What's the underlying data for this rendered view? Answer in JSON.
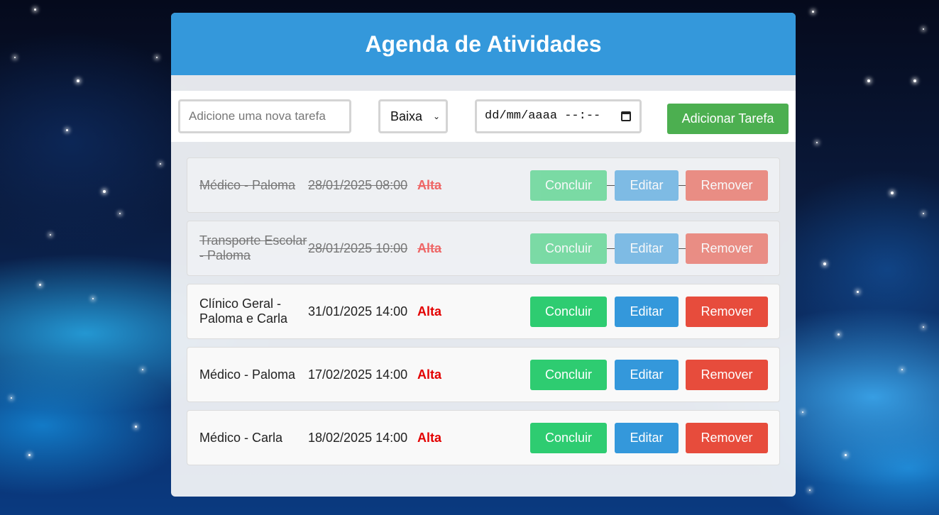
{
  "app": {
    "title": "Agenda de Atividades"
  },
  "form": {
    "task_placeholder": "Adicione uma nova tarefa",
    "priority_selected": "Baixa",
    "datetime_placeholder": "dd/mm/aaaa --:--",
    "add_label": "Adicionar Tarefa"
  },
  "tasks": [
    {
      "name": "Médico - Paloma",
      "date": "28/01/2025 08:00",
      "priority": "Alta",
      "completed": true
    },
    {
      "name": "Transporte Escolar - Paloma",
      "date": "28/01/2025 10:00",
      "priority": "Alta",
      "completed": true
    },
    {
      "name": "Clínico Geral - Paloma e Carla",
      "date": "31/01/2025 14:00",
      "priority": "Alta",
      "completed": false
    },
    {
      "name": "Médico - Paloma",
      "date": "17/02/2025 14:00",
      "priority": "Alta",
      "completed": false
    },
    {
      "name": "Médico - Carla",
      "date": "18/02/2025 14:00",
      "priority": "Alta",
      "completed": false
    }
  ],
  "actions": {
    "conclude_label": "Concluir",
    "edit_label": "Editar",
    "remove_label": "Remover"
  },
  "colors": {
    "header": "#3498db",
    "add_button": "#4caf50",
    "conclude": "#2ecc71",
    "edit": "#3498db",
    "remove": "#e74c3c",
    "priority_high": "#e30000"
  },
  "icons": {
    "select_arrow": "chevron-down-icon",
    "datetime_picker": "calendar-icon"
  }
}
